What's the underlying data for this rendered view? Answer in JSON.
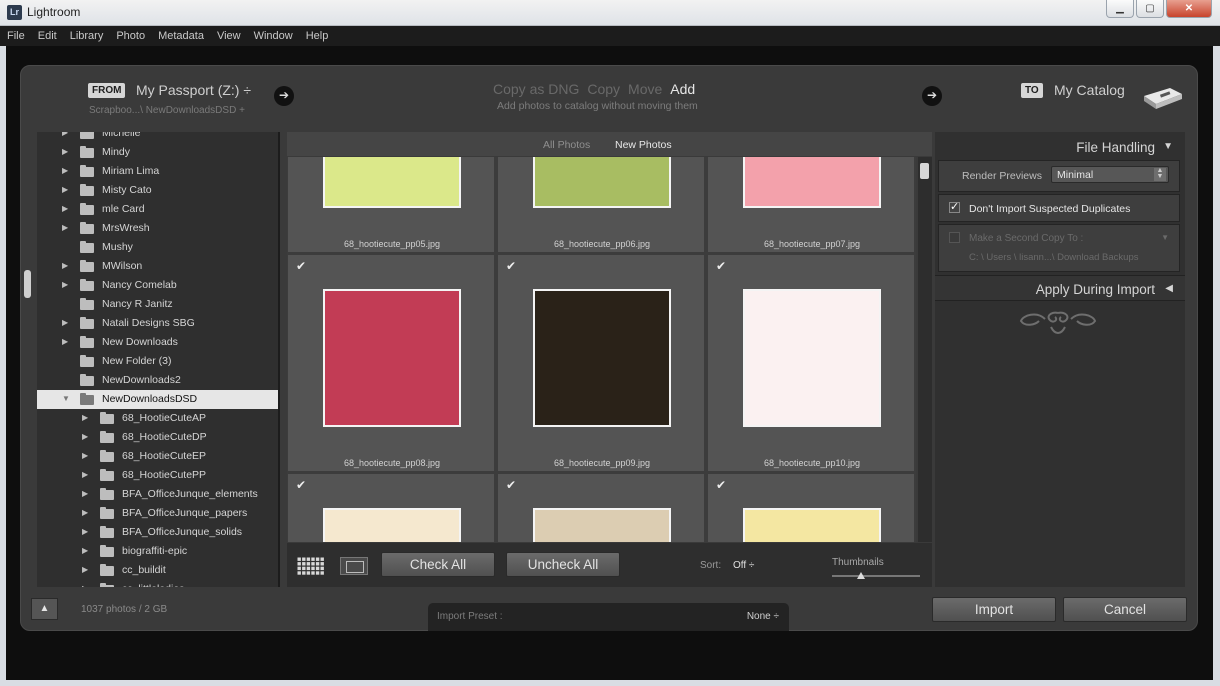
{
  "window": {
    "icon_text": "Lr",
    "title": "Lightroom",
    "minimize": "▁",
    "maximize": "▢",
    "close": "✕"
  },
  "menu": [
    "File",
    "Edit",
    "Library",
    "Photo",
    "Metadata",
    "View",
    "Window",
    "Help"
  ],
  "header": {
    "from_badge": "FROM",
    "from_source": "My Passport (Z:) ÷",
    "from_path": "Scrapboo...\\ NewDownloadsDSD +",
    "modes": [
      "Copy as DNG",
      "Copy",
      "Move",
      "Add"
    ],
    "active_mode": "Add",
    "mode_description": "Add photos to catalog without moving them",
    "to_badge": "TO",
    "to_destination": "My Catalog"
  },
  "source_tree": [
    {
      "label": "Michelle",
      "indent": 0,
      "expand": true
    },
    {
      "label": "Mindy",
      "indent": 0,
      "expand": true
    },
    {
      "label": "Miriam Lima",
      "indent": 0,
      "expand": true
    },
    {
      "label": "Misty Cato",
      "indent": 0,
      "expand": true
    },
    {
      "label": "mle Card",
      "indent": 0,
      "expand": true
    },
    {
      "label": "MrsWresh",
      "indent": 0,
      "expand": true
    },
    {
      "label": "Mushy",
      "indent": 0,
      "expand": false
    },
    {
      "label": "MWilson",
      "indent": 0,
      "expand": true
    },
    {
      "label": "Nancy Comelab",
      "indent": 0,
      "expand": true
    },
    {
      "label": "Nancy R Janitz",
      "indent": 0,
      "expand": false
    },
    {
      "label": "Natali Designs SBG",
      "indent": 0,
      "expand": true
    },
    {
      "label": "New Downloads",
      "indent": 0,
      "expand": true
    },
    {
      "label": "New Folder (3)",
      "indent": 0,
      "expand": false
    },
    {
      "label": "NewDownloads2",
      "indent": 0,
      "expand": false
    },
    {
      "label": "NewDownloadsDSD",
      "indent": 0,
      "expand": "open",
      "selected": true
    },
    {
      "label": "68_HootieCuteAP",
      "indent": 1,
      "expand": true
    },
    {
      "label": "68_HootieCuteDP",
      "indent": 1,
      "expand": true
    },
    {
      "label": "68_HootieCuteEP",
      "indent": 1,
      "expand": true
    },
    {
      "label": "68_HootieCutePP",
      "indent": 1,
      "expand": true
    },
    {
      "label": "BFA_OfficeJunque_elements",
      "indent": 1,
      "expand": true
    },
    {
      "label": "BFA_OfficeJunque_papers",
      "indent": 1,
      "expand": true
    },
    {
      "label": "BFA_OfficeJunque_solids",
      "indent": 1,
      "expand": true
    },
    {
      "label": "biograffiti-epic",
      "indent": 1,
      "expand": true
    },
    {
      "label": "cc_buildit",
      "indent": 1,
      "expand": true
    },
    {
      "label": "cc_littleladies",
      "indent": 1,
      "expand": true
    }
  ],
  "grid_tabs": {
    "all": "All Photos",
    "new": "New Photos"
  },
  "photos": [
    {
      "name": "68_hootiecute_pp05.jpg",
      "color": "#dbe88a",
      "checked": true
    },
    {
      "name": "68_hootiecute_pp06.jpg",
      "color": "#a8bd62",
      "checked": true
    },
    {
      "name": "68_hootiecute_pp07.jpg",
      "color": "#f3a1ab",
      "checked": true
    },
    {
      "name": "68_hootiecute_pp08.jpg",
      "color": "#c23c55",
      "checked": true
    },
    {
      "name": "68_hootiecute_pp09.jpg",
      "color": "#2a2218",
      "checked": true
    },
    {
      "name": "68_hootiecute_pp10.jpg",
      "color": "#fbf1f1",
      "checked": true
    },
    {
      "name": "",
      "color": "#f5e8cf",
      "checked": true
    },
    {
      "name": "",
      "color": "#dccdb2",
      "checked": true
    },
    {
      "name": "",
      "color": "#f4e7a2",
      "checked": true
    }
  ],
  "toolbar": {
    "check_all": "Check All",
    "uncheck_all": "Uncheck All",
    "sort_label": "Sort:",
    "sort_value": "Off ÷",
    "thumbnails_label": "Thumbnails",
    "thumbnails_level": 0.33
  },
  "right_panel": {
    "file_handling": "File Handling",
    "render_previews_label": "Render Previews",
    "render_previews_value": "Minimal",
    "dont_import_duplicates": "Don't Import Suspected Duplicates",
    "dont_import_checked": true,
    "second_copy": "Make a Second Copy To :",
    "second_copy_path": "C: \\ Users \\ lisann...\\ Download Backups",
    "apply_during_import": "Apply During Import"
  },
  "footer": {
    "photo_count": "1037 photos / 2 GB",
    "import_preset_label": "Import Preset :",
    "import_preset_value": "None ÷",
    "import_button": "Import",
    "cancel_button": "Cancel"
  }
}
